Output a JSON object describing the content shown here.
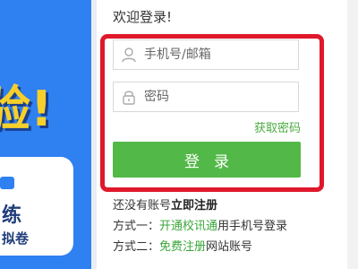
{
  "banner": {
    "headline": "验!",
    "card_line1": "练",
    "card_line2": "拟卷"
  },
  "form": {
    "title": "欢迎登录!",
    "username_placeholder": "手机号/邮箱",
    "password_placeholder": "密码",
    "forgot_label": "获取密码",
    "login_label": "登录"
  },
  "footer": {
    "no_account_text": "还没有账号",
    "register_now": "立即注册",
    "method1_prefix": "方式一：",
    "method1_link": "开通校讯通",
    "method1_suffix": "用手机号登录",
    "method2_prefix": "方式二：",
    "method2_link": "免费注册",
    "method2_suffix": "网站账号"
  },
  "colors": {
    "accent_green": "#52b848",
    "link_green": "#3aa53a",
    "annotation_red": "#e0182b",
    "banner_blue": "#2f80f0",
    "banner_yellow": "#f6cf2a"
  },
  "icons": {
    "username": "user-icon",
    "password": "lock-icon"
  }
}
